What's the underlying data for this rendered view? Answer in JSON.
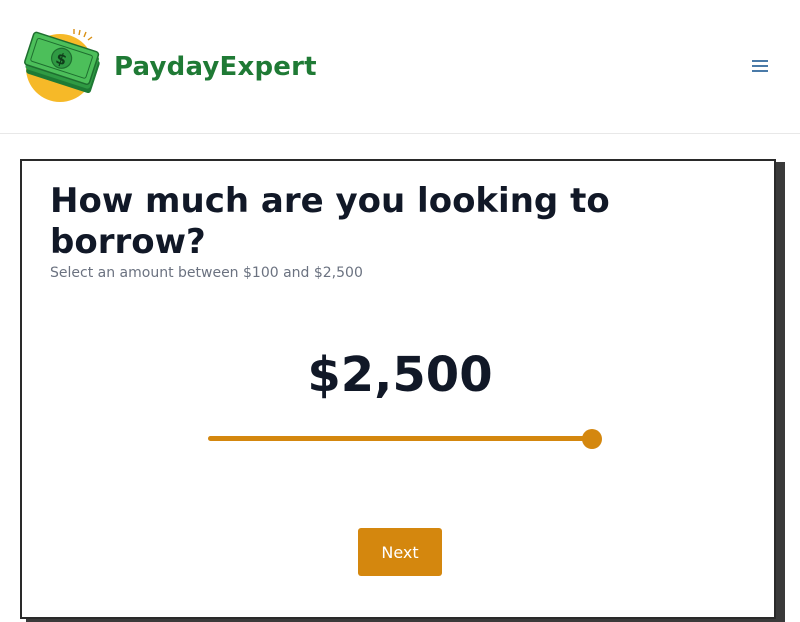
{
  "header": {
    "brand_name": "PaydayExpert",
    "logo_icon": "money-bills-sun-logo",
    "menu_icon": "hamburger-menu-icon"
  },
  "colors": {
    "brand_green": "#1f7a35",
    "accent_orange": "#d4870e",
    "text_dark": "#111827",
    "text_muted": "#6b7280"
  },
  "form": {
    "title": "How much are you looking to borrow?",
    "subtitle": "Select an amount between $100 and $2,500",
    "amount_display": "$2,500",
    "slider": {
      "min": 100,
      "max": 2500,
      "value": 2500
    },
    "next_label": "Next"
  }
}
